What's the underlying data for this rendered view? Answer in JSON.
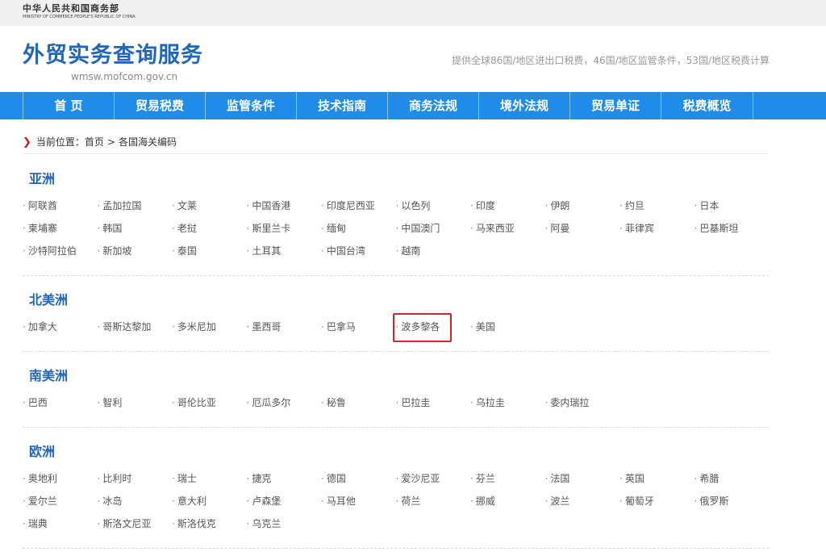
{
  "ministry": {
    "name_cn": "中华人民共和国商务部",
    "name_en": "MINISTRY OF COMMERCE PEOPLE'S REPUBLIC OF CHINA"
  },
  "header": {
    "title": "外贸实务查询服务",
    "domain": "wmsw.mofcom.gov.cn",
    "tagline": "提供全球86国/地区进出口税费，46国/地区监管条件，53国/地区税费计算"
  },
  "nav": [
    "首 页",
    "贸易税费",
    "监管条件",
    "技术指南",
    "商务法规",
    "境外法规",
    "贸易单证",
    "税费概览"
  ],
  "breadcrumb": {
    "prefix": "当前位置：",
    "home": "首页",
    "separator": ">",
    "current": "各国海关编码"
  },
  "regions": [
    {
      "name": "亚洲",
      "countries": [
        "阿联酋",
        "孟加拉国",
        "文莱",
        "中国香港",
        "印度尼西亚",
        "以色列",
        "印度",
        "伊朗",
        "约旦",
        "日本",
        "柬埔寨",
        "韩国",
        "老挝",
        "斯里兰卡",
        "缅甸",
        "中国澳门",
        "马来西亚",
        "阿曼",
        "菲律宾",
        "巴基斯坦",
        "沙特阿拉伯",
        "新加坡",
        "泰国",
        "土耳其",
        "中国台湾",
        "越南"
      ]
    },
    {
      "name": "北美洲",
      "countries": [
        "加拿大",
        "哥斯达黎加",
        "多米尼加",
        "墨西哥",
        "巴拿马",
        "波多黎各",
        "美国"
      ]
    },
    {
      "name": "南美洲",
      "countries": [
        "巴西",
        "智利",
        "哥伦比亚",
        "厄瓜多尔",
        "秘鲁",
        "巴拉圭",
        "乌拉圭",
        "委内瑞拉"
      ]
    },
    {
      "name": "欧洲",
      "countries": [
        "奥地利",
        "比利时",
        "瑞士",
        "捷克",
        "德国",
        "爱沙尼亚",
        "芬兰",
        "法国",
        "英国",
        "希腊",
        "爱尔兰",
        "冰岛",
        "意大利",
        "卢森堡",
        "马耳他",
        "荷兰",
        "挪威",
        "波兰",
        "葡萄牙",
        "俄罗斯",
        "瑞典",
        "斯洛文尼亚",
        "斯洛伐克",
        "乌克兰"
      ]
    }
  ],
  "highlighted_country": "波多黎各",
  "colors": {
    "brand_blue": "#2166b8",
    "nav_blue": "#1e8ce8",
    "highlight_red": "#d9232a"
  }
}
